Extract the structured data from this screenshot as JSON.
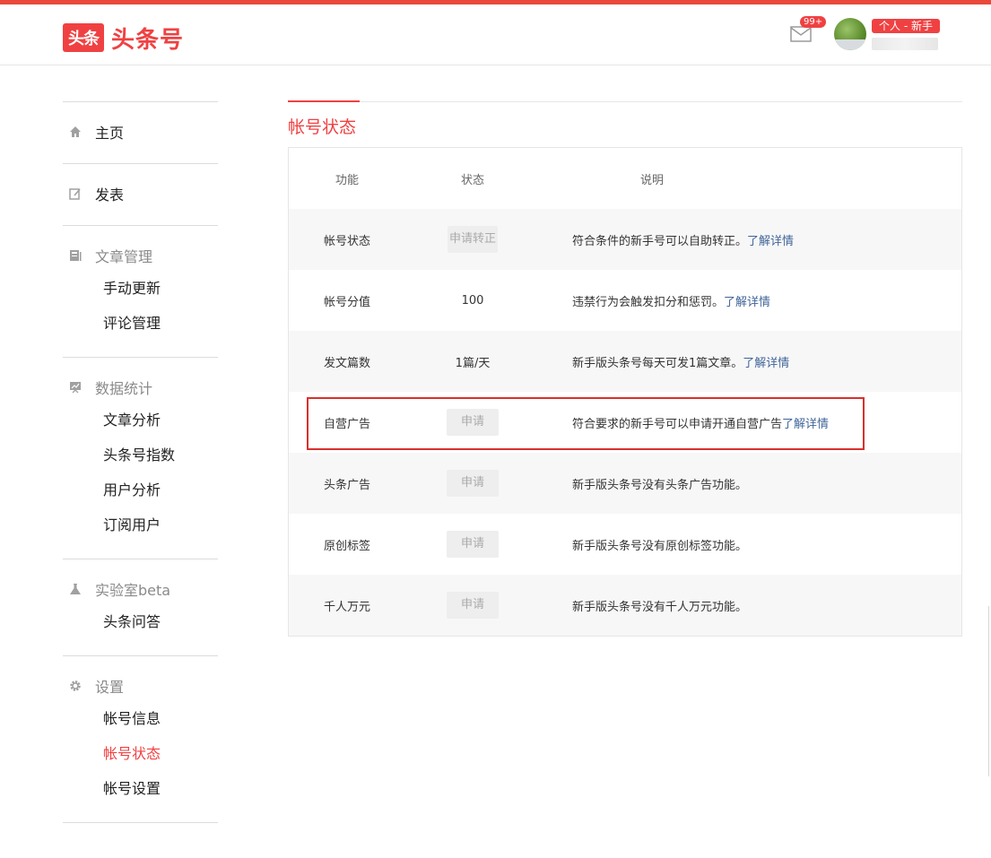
{
  "header": {
    "logo_badge": "头条",
    "logo_text": "头条号",
    "mail_count": "99+",
    "user_tag": "个人 - 新手"
  },
  "sidebar": {
    "home": "主页",
    "publish": "发表",
    "article_mgmt": "文章管理",
    "article_items": [
      "手动更新",
      "评论管理"
    ],
    "data_stats": "数据统计",
    "data_items": [
      "文章分析",
      "头条号指数",
      "用户分析",
      "订阅用户"
    ],
    "lab": "实验室beta",
    "lab_items": [
      "头条问答"
    ],
    "settings": "设置",
    "settings_items": [
      "帐号信息",
      "帐号状态",
      "帐号设置"
    ]
  },
  "main": {
    "title": "帐号状态",
    "columns": [
      "功能",
      "状态",
      "说明"
    ],
    "rows": [
      {
        "feature": "帐号状态",
        "status": "申请转正",
        "desc": "符合条件的新手号可以自助转正。",
        "link": "了解详情"
      },
      {
        "feature": "帐号分值",
        "status": "100",
        "desc": "违禁行为会触发扣分和惩罚。",
        "link": "了解详情"
      },
      {
        "feature": "发文篇数",
        "status": "1篇/天",
        "desc": "新手版头条号每天可发1篇文章。",
        "link": "了解详情"
      },
      {
        "feature": "自营广告",
        "status": "申请",
        "desc": "符合要求的新手号可以申请开通自营广告",
        "link": "了解详情"
      },
      {
        "feature": "头条广告",
        "status": "申请",
        "desc": "新手版头条号没有头条广告功能。",
        "link": ""
      },
      {
        "feature": "原创标签",
        "status": "申请",
        "desc": "新手版头条号没有原创标签功能。",
        "link": ""
      },
      {
        "feature": "千人万元",
        "status": "申请",
        "desc": "新手版头条号没有千人万元功能。",
        "link": ""
      }
    ]
  },
  "colors": {
    "brand": "#f04142",
    "link": "#406599",
    "highlight": "#d9302c"
  }
}
